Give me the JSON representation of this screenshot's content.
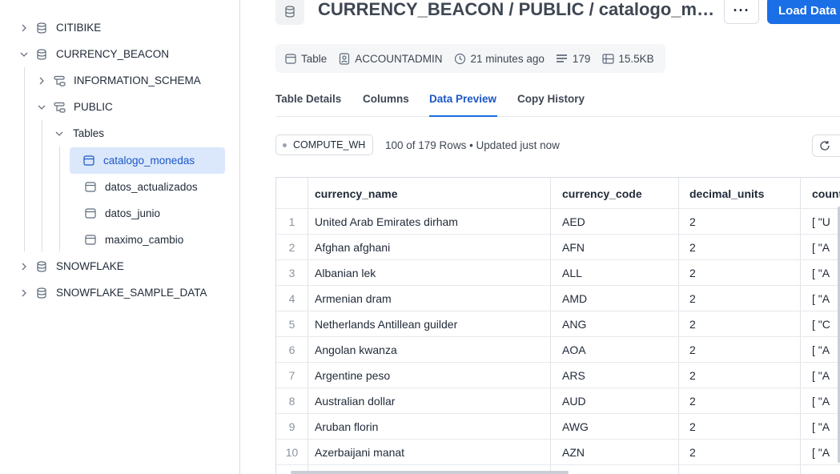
{
  "sidebar": {
    "items": [
      {
        "label": "CITIBIKE",
        "icon": "database-icon",
        "expanded": false
      },
      {
        "label": "CURRENCY_BEACON",
        "icon": "database-icon",
        "expanded": true
      },
      {
        "label": "INFORMATION_SCHEMA",
        "icon": "schema-icon",
        "expanded": false
      },
      {
        "label": "PUBLIC",
        "icon": "schema-icon",
        "expanded": true
      },
      {
        "label": "Tables",
        "icon": "",
        "expanded": true
      },
      {
        "label": "catalogo_monedas",
        "icon": "table-icon",
        "selected": true
      },
      {
        "label": "datos_actualizados",
        "icon": "table-icon"
      },
      {
        "label": "datos_junio",
        "icon": "table-icon"
      },
      {
        "label": "maximo_cambio",
        "icon": "table-icon"
      },
      {
        "label": "SNOWFLAKE",
        "icon": "database-icon",
        "expanded": false
      },
      {
        "label": "SNOWFLAKE_SAMPLE_DATA",
        "icon": "database-icon",
        "expanded": false
      }
    ]
  },
  "header": {
    "title": "CURRENCY_BEACON / PUBLIC / catalogo_monedas",
    "more_label": "···",
    "load_label": "Load Data"
  },
  "meta": {
    "type": "Table",
    "owner": "ACCOUNTADMIN",
    "updated": "21 minutes ago",
    "row_count": "179",
    "size": "15.5KB"
  },
  "tabs": [
    {
      "label": "Table Details",
      "active": false
    },
    {
      "label": "Columns",
      "active": false
    },
    {
      "label": "Data Preview",
      "active": true
    },
    {
      "label": "Copy History",
      "active": false
    }
  ],
  "preview": {
    "warehouse": "COMPUTE_WH",
    "rows_info": "100 of 179 Rows • Updated just now",
    "columns": [
      "currency_name",
      "currency_code",
      "decimal_units",
      "countries"
    ],
    "rows": [
      {
        "n": "1",
        "name": "United Arab Emirates dirham",
        "code": "AED",
        "units": "2",
        "countries": "[  \"U"
      },
      {
        "n": "2",
        "name": "Afghan afghani",
        "code": "AFN",
        "units": "2",
        "countries": "[  \"A"
      },
      {
        "n": "3",
        "name": "Albanian lek",
        "code": "ALL",
        "units": "2",
        "countries": "[  \"A"
      },
      {
        "n": "4",
        "name": "Armenian dram",
        "code": "AMD",
        "units": "2",
        "countries": "[  \"A"
      },
      {
        "n": "5",
        "name": "Netherlands Antillean guilder",
        "code": "ANG",
        "units": "2",
        "countries": "[  \"C"
      },
      {
        "n": "6",
        "name": "Angolan kwanza",
        "code": "AOA",
        "units": "2",
        "countries": "[  \"A"
      },
      {
        "n": "7",
        "name": "Argentine peso",
        "code": "ARS",
        "units": "2",
        "countries": "[  \"A"
      },
      {
        "n": "8",
        "name": "Australian dollar",
        "code": "AUD",
        "units": "2",
        "countries": "[  \"A"
      },
      {
        "n": "9",
        "name": "Aruban florin",
        "code": "AWG",
        "units": "2",
        "countries": "[  \"A"
      },
      {
        "n": "10",
        "name": "Azerbaijani manat",
        "code": "AZN",
        "units": "2",
        "countries": "[  \"A"
      }
    ]
  },
  "colors": {
    "accent": "#1a6ee6",
    "selected_bg": "#dbe7fb",
    "border": "#d8dce3"
  }
}
